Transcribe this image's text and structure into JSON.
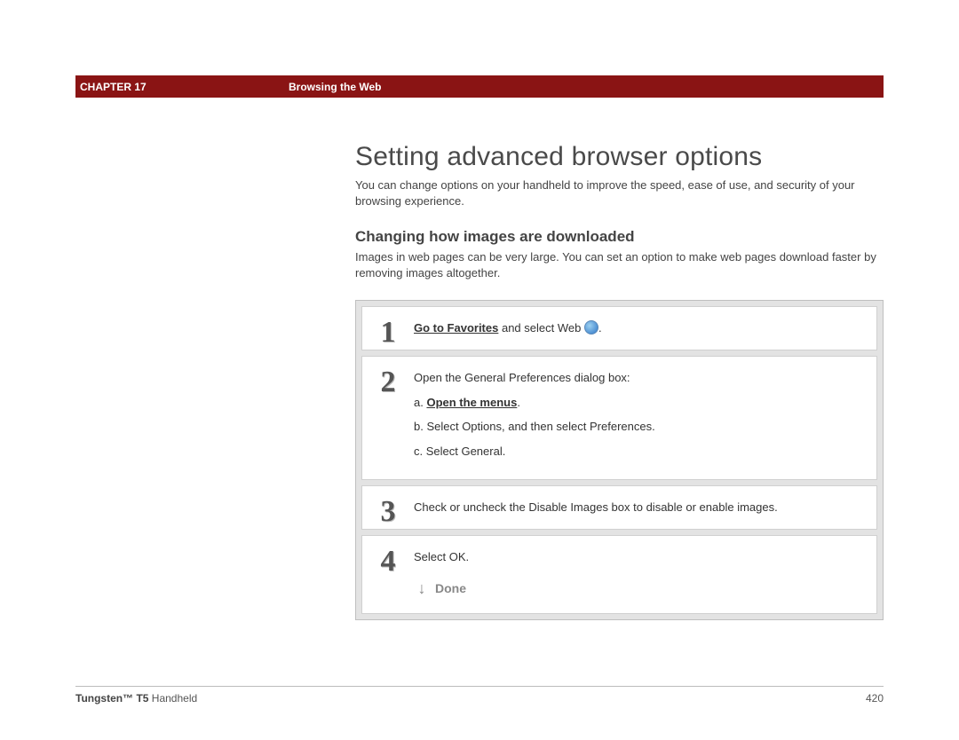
{
  "header": {
    "chapter": "CHAPTER 17",
    "section": "Browsing the Web"
  },
  "main": {
    "h1": "Setting advanced browser options",
    "intro": "You can change options on your handheld to improve the speed, ease of use, and security of your browsing experience.",
    "h2": "Changing how images are downloaded",
    "sub_intro": "Images in web pages can be very large. You can set an option to make web pages download faster by removing images altogether."
  },
  "steps": {
    "s1": {
      "num": "1",
      "link": "Go to Favorites",
      "rest": " and select Web "
    },
    "s2": {
      "num": "2",
      "line1": "Open the General Preferences dialog box:",
      "a_label": "a.  ",
      "a_link": "Open the menus",
      "a_after": ".",
      "b": "b.  Select Options, and then select Preferences.",
      "c": "c.  Select General."
    },
    "s3": {
      "num": "3",
      "text": "Check or uncheck the Disable Images box to disable or enable images."
    },
    "s4": {
      "num": "4",
      "text": "Select OK."
    },
    "done": "Done"
  },
  "footer": {
    "product_bold": "Tungsten™ T5",
    "product_rest": " Handheld",
    "page": "420"
  }
}
